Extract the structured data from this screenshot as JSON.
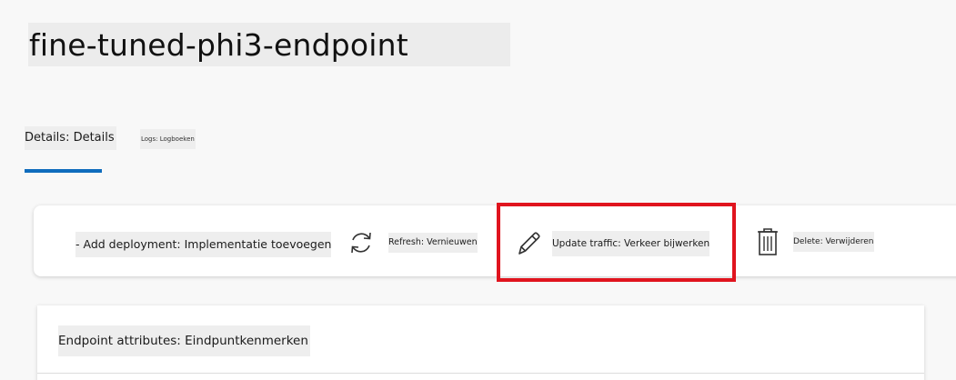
{
  "header": {
    "title": "fine-tuned-phi3-endpoint"
  },
  "tabs": [
    {
      "label": "Details: Details",
      "selected": true
    },
    {
      "label": "Logs: Logboeken",
      "selected": false
    }
  ],
  "toolbar": {
    "add_deployment_label": "- Add deployment: Implementatie toevoegen",
    "refresh_label": "Refresh: Vernieuwen",
    "update_traffic_label": "Update traffic: Verkeer bijwerken",
    "delete_label": "Delete: Verwijderen",
    "icons": [
      "refresh-icon",
      "pencil-icon",
      "trash-icon"
    ]
  },
  "endpoint_attributes": {
    "title": "Endpoint attributes: Eindpuntkenmerken"
  },
  "colors": {
    "tab_underline": "#0f6cbd",
    "highlight_border": "#e0141e",
    "page_background": "#f8f8f8"
  }
}
